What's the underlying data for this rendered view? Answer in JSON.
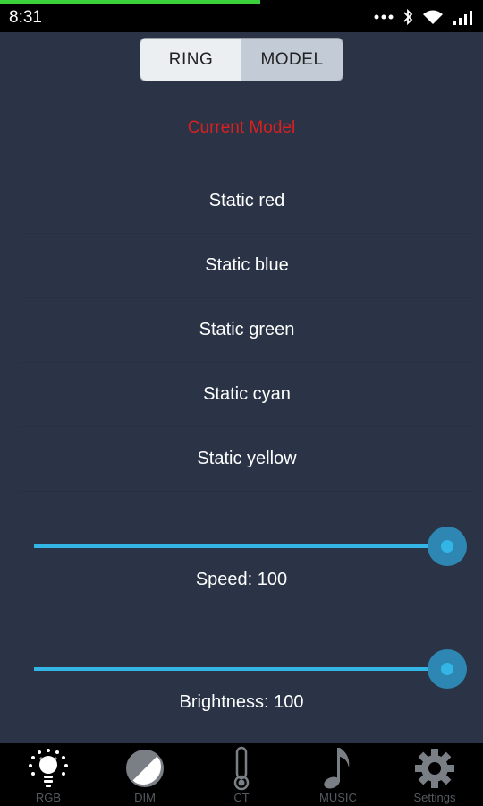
{
  "status_bar": {
    "time": "8:31",
    "icons": [
      "more-dots-icon",
      "bluetooth-icon",
      "wifi-icon",
      "signal-icon"
    ]
  },
  "mode_toggle": {
    "options": [
      "RING",
      "MODEL"
    ],
    "selected": "MODEL"
  },
  "current_model_label": "Current Model",
  "models": [
    "Static red",
    "Static blue",
    "Static green",
    "Static cyan",
    "Static yellow"
  ],
  "speed": {
    "label": "Speed: 100",
    "value": 100,
    "max": 100
  },
  "brightness": {
    "label": "Brightness: 100",
    "value": 100,
    "max": 100
  },
  "bottom_nav": [
    {
      "label": "RGB",
      "icon": "rgb-bulb-icon"
    },
    {
      "label": "DIM",
      "icon": "dim-half-circle-icon"
    },
    {
      "label": "CT",
      "icon": "thermometer-icon"
    },
    {
      "label": "MUSIC",
      "icon": "music-note-icon"
    },
    {
      "label": "Settings",
      "icon": "gear-icon"
    }
  ],
  "colors": {
    "background": "#2b3446",
    "accent": "#33b5e5",
    "current_model": "#d92020"
  }
}
